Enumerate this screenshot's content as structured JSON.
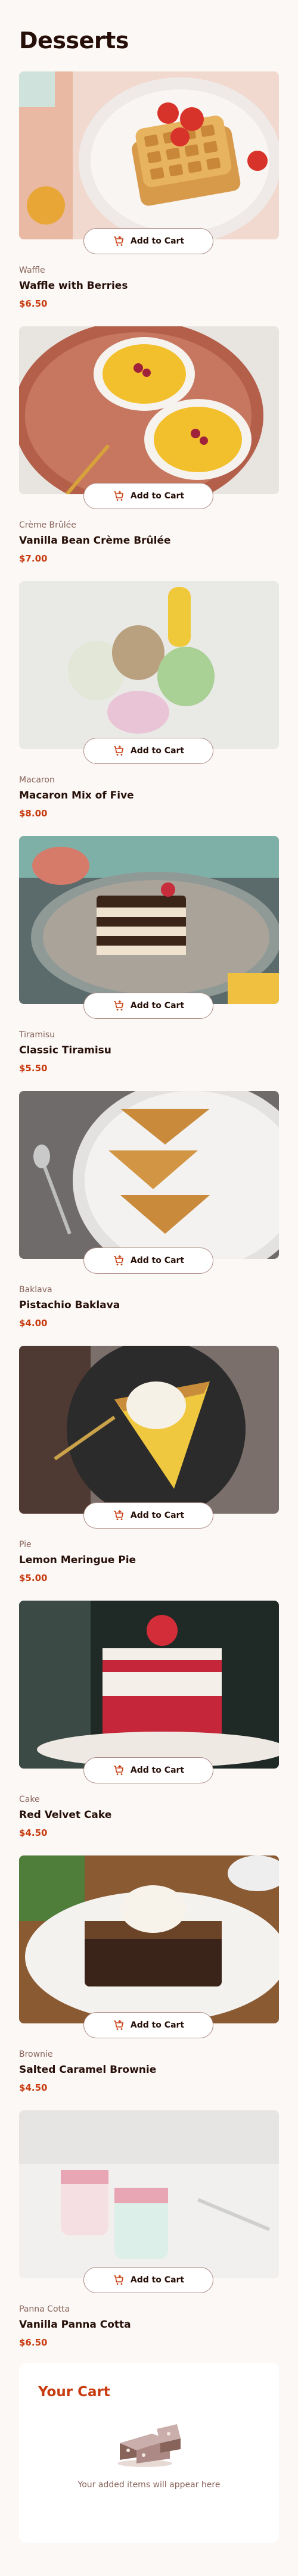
{
  "page": {
    "title": "Desserts"
  },
  "colors": {
    "accent": "#c73b0f",
    "text_dark": "#260f08",
    "text_muted": "#87635a",
    "background": "#fcf8f5"
  },
  "products": [
    {
      "category": "Waffle",
      "name": "Waffle with Berries",
      "price": "$6.50",
      "button_label": "Add to Cart",
      "image_icon": "waffle-photo"
    },
    {
      "category": "Crème Brûlée",
      "name": "Vanilla Bean Crème Brûlée",
      "price": "$7.00",
      "button_label": "Add to Cart",
      "image_icon": "creme-brulee-photo"
    },
    {
      "category": "Macaron",
      "name": "Macaron Mix of Five",
      "price": "$8.00",
      "button_label": "Add to Cart",
      "image_icon": "macaron-photo"
    },
    {
      "category": "Tiramisu",
      "name": "Classic Tiramisu",
      "price": "$5.50",
      "button_label": "Add to Cart",
      "image_icon": "tiramisu-photo"
    },
    {
      "category": "Baklava",
      "name": "Pistachio Baklava",
      "price": "$4.00",
      "button_label": "Add to Cart",
      "image_icon": "baklava-photo"
    },
    {
      "category": "Pie",
      "name": "Lemon Meringue Pie",
      "price": "$5.00",
      "button_label": "Add to Cart",
      "image_icon": "pie-photo"
    },
    {
      "category": "Cake",
      "name": "Red Velvet Cake",
      "price": "$4.50",
      "button_label": "Add to Cart",
      "image_icon": "cake-photo"
    },
    {
      "category": "Brownie",
      "name": "Salted Caramel Brownie",
      "price": "$4.50",
      "button_label": "Add to Cart",
      "image_icon": "brownie-photo"
    },
    {
      "category": "Panna Cotta",
      "name": "Vanilla Panna Cotta",
      "price": "$6.50",
      "button_label": "Add to Cart",
      "image_icon": "panna-cotta-photo"
    }
  ],
  "cart": {
    "title": "Your Cart",
    "empty_message": "Your added items will appear here",
    "empty_icon": "empty-cake-illustration"
  }
}
